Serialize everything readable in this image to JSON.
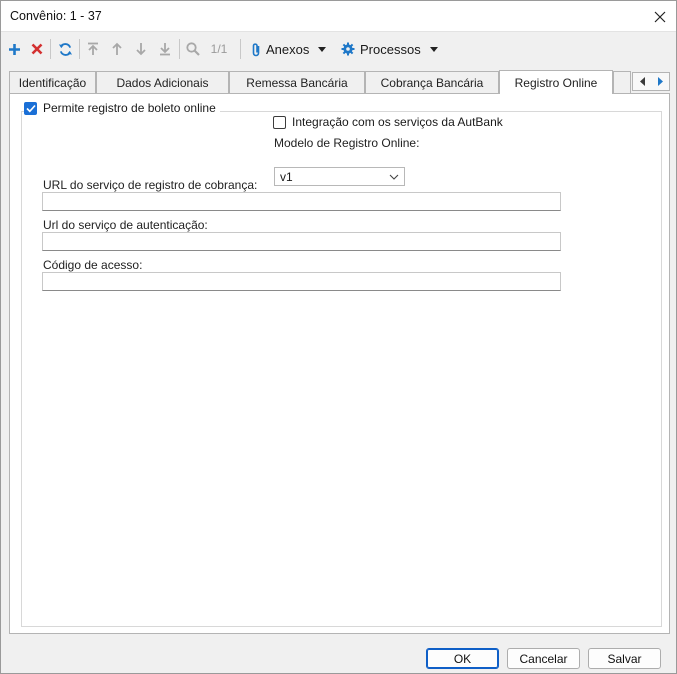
{
  "window": {
    "title": "Convênio: 1 - 37"
  },
  "toolbar": {
    "add_icon": "plus-icon",
    "delete_icon": "x-icon",
    "refresh_icon": "refresh-icon",
    "first_icon": "arrow-first-icon",
    "up_icon": "arrow-up-icon",
    "down_icon": "arrow-down-icon",
    "last_icon": "arrow-last-icon",
    "search_icon": "search-icon",
    "paging": "1/1",
    "anexos_label": "Anexos",
    "processos_label": "Processos"
  },
  "tabs": [
    {
      "label": "Identificação"
    },
    {
      "label": "Dados Adicionais"
    },
    {
      "label": "Remessa Bancária"
    },
    {
      "label": "Cobrança Bancária"
    },
    {
      "label": "Registro Online"
    }
  ],
  "form": {
    "permite_label": "Permite registro de boleto online",
    "permite_checked": true,
    "integracao_label": "Integração com os serviços da AutBank",
    "integracao_checked": false,
    "modelo_label": "Modelo de Registro Online:",
    "modelo_value": "v1",
    "url_cobranca_label": "URL do serviço de registro de cobrança:",
    "url_cobranca_value": "",
    "url_autenticacao_label": "Url do serviço de autenticação:",
    "url_autenticacao_value": "",
    "codigo_label": "Código de acesso:",
    "codigo_value": ""
  },
  "footer": {
    "ok_label": "OK",
    "cancel_label": "Cancelar",
    "save_label": "Salvar"
  },
  "colors": {
    "accent": "#1a6fd6",
    "delete": "#d33030",
    "toolbar_icon": "#1f78c8"
  }
}
